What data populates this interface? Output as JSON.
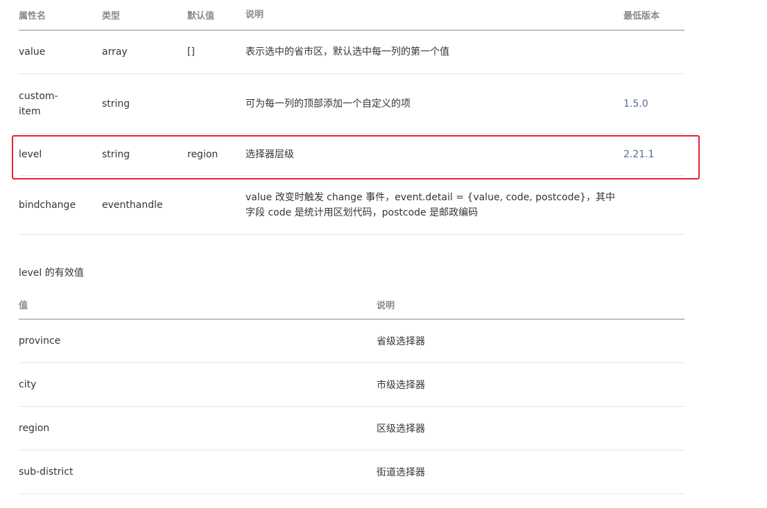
{
  "attr_table": {
    "headers": {
      "name": "属性名",
      "type": "类型",
      "default": "默认值",
      "desc": "说明",
      "version": "最低版本"
    },
    "rows": [
      {
        "name": "value",
        "type": "array",
        "default": "[]",
        "desc": "表示选中的省市区，默认选中每一列的第一个值",
        "version": ""
      },
      {
        "name": "custom-item",
        "type": "string",
        "default": "",
        "desc": "可为每一列的顶部添加一个自定义的项",
        "version": "1.5.0"
      },
      {
        "name": "level",
        "type": "string",
        "default": "region",
        "desc": "选择器层级",
        "version": "2.21.1"
      },
      {
        "name": "bindchange",
        "type": "eventhandle",
        "default": "",
        "desc": "value 改变时触发 change 事件，event.detail = {value, code, postcode}，其中字段 code 是统计用区划代码，postcode 是邮政编码",
        "version": ""
      }
    ]
  },
  "level_section": {
    "title": "level 的有效值",
    "headers": {
      "value": "值",
      "desc": "说明"
    },
    "rows": [
      {
        "value": "province",
        "desc": "省级选择器"
      },
      {
        "value": "city",
        "desc": "市级选择器"
      },
      {
        "value": "region",
        "desc": "区级选择器"
      },
      {
        "value": "sub-district",
        "desc": "街道选择器"
      }
    ]
  },
  "colors": {
    "version_link": "#576b95",
    "highlight_border": "#e8202a",
    "header_text": "#8a8a8a"
  }
}
